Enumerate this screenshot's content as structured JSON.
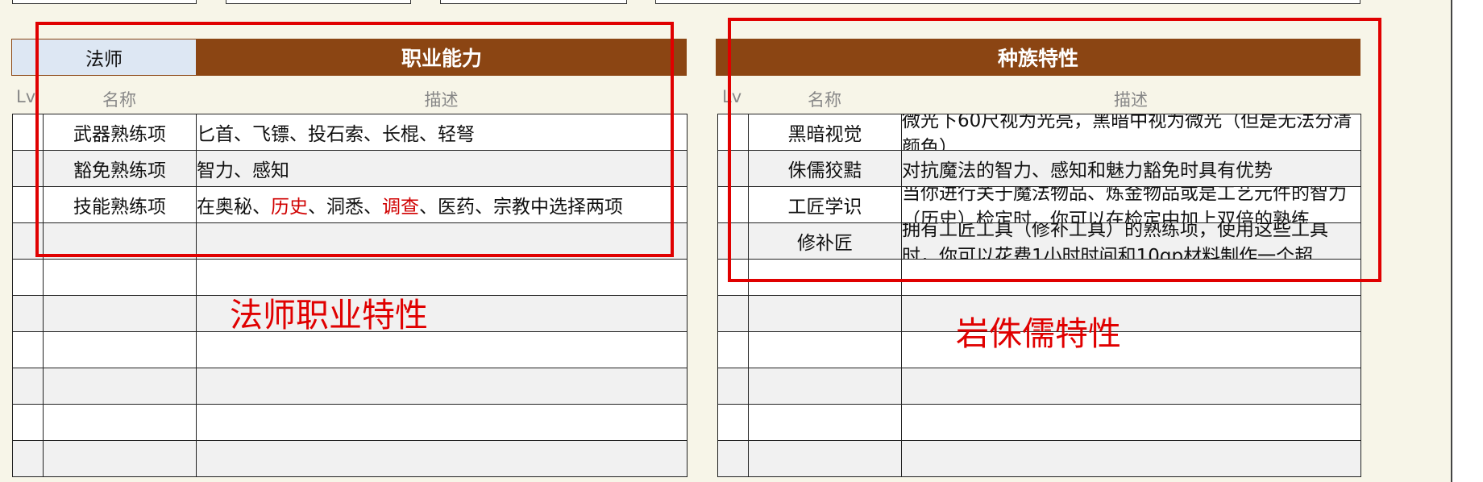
{
  "left_panel": {
    "class_name": "法师",
    "title": "职业能力",
    "col_lv": "Lv",
    "col_name": "名称",
    "col_desc": "描述",
    "rows": [
      {
        "name": "武器熟练项",
        "desc": "匕首、飞镖、投石索、长棍、轻弩"
      },
      {
        "name": "豁免熟练项",
        "desc": "智力、感知"
      },
      {
        "name": "技能熟练项",
        "desc_parts": [
          "在奥秘、",
          "历史",
          "、洞悉、",
          "调查",
          "、医药、宗教中选择两项"
        ]
      }
    ],
    "annotation": "法师职业特性"
  },
  "right_panel": {
    "title": "种族特性",
    "col_lv": "Lv",
    "col_name": "名称",
    "col_desc": "描述",
    "rows": [
      {
        "name": "黑暗视觉",
        "desc": "微光下60尺视为光亮，黑暗中视为微光（但是无法分清颜色）"
      },
      {
        "name": "侏儒狡黠",
        "desc": "对抗魔法的智力、感知和魅力豁免时具有优势"
      },
      {
        "name": "工匠学识",
        "desc": "当你进行关于魔法物品、炼金物品或是工艺元件的智力（历史）检定时，你可以在检定中加上双倍的熟练"
      },
      {
        "name": "修补匠",
        "desc": "拥有工匠工具（修补工具）的熟练项，使用这些工具时，你可以花费1小时时间和10gp材料制作一个超"
      }
    ],
    "annotation": "岩侏儒特性"
  },
  "colors": {
    "banner": "#8b4513",
    "class_cell": "#dde7f3",
    "highlight": "#e00000"
  }
}
